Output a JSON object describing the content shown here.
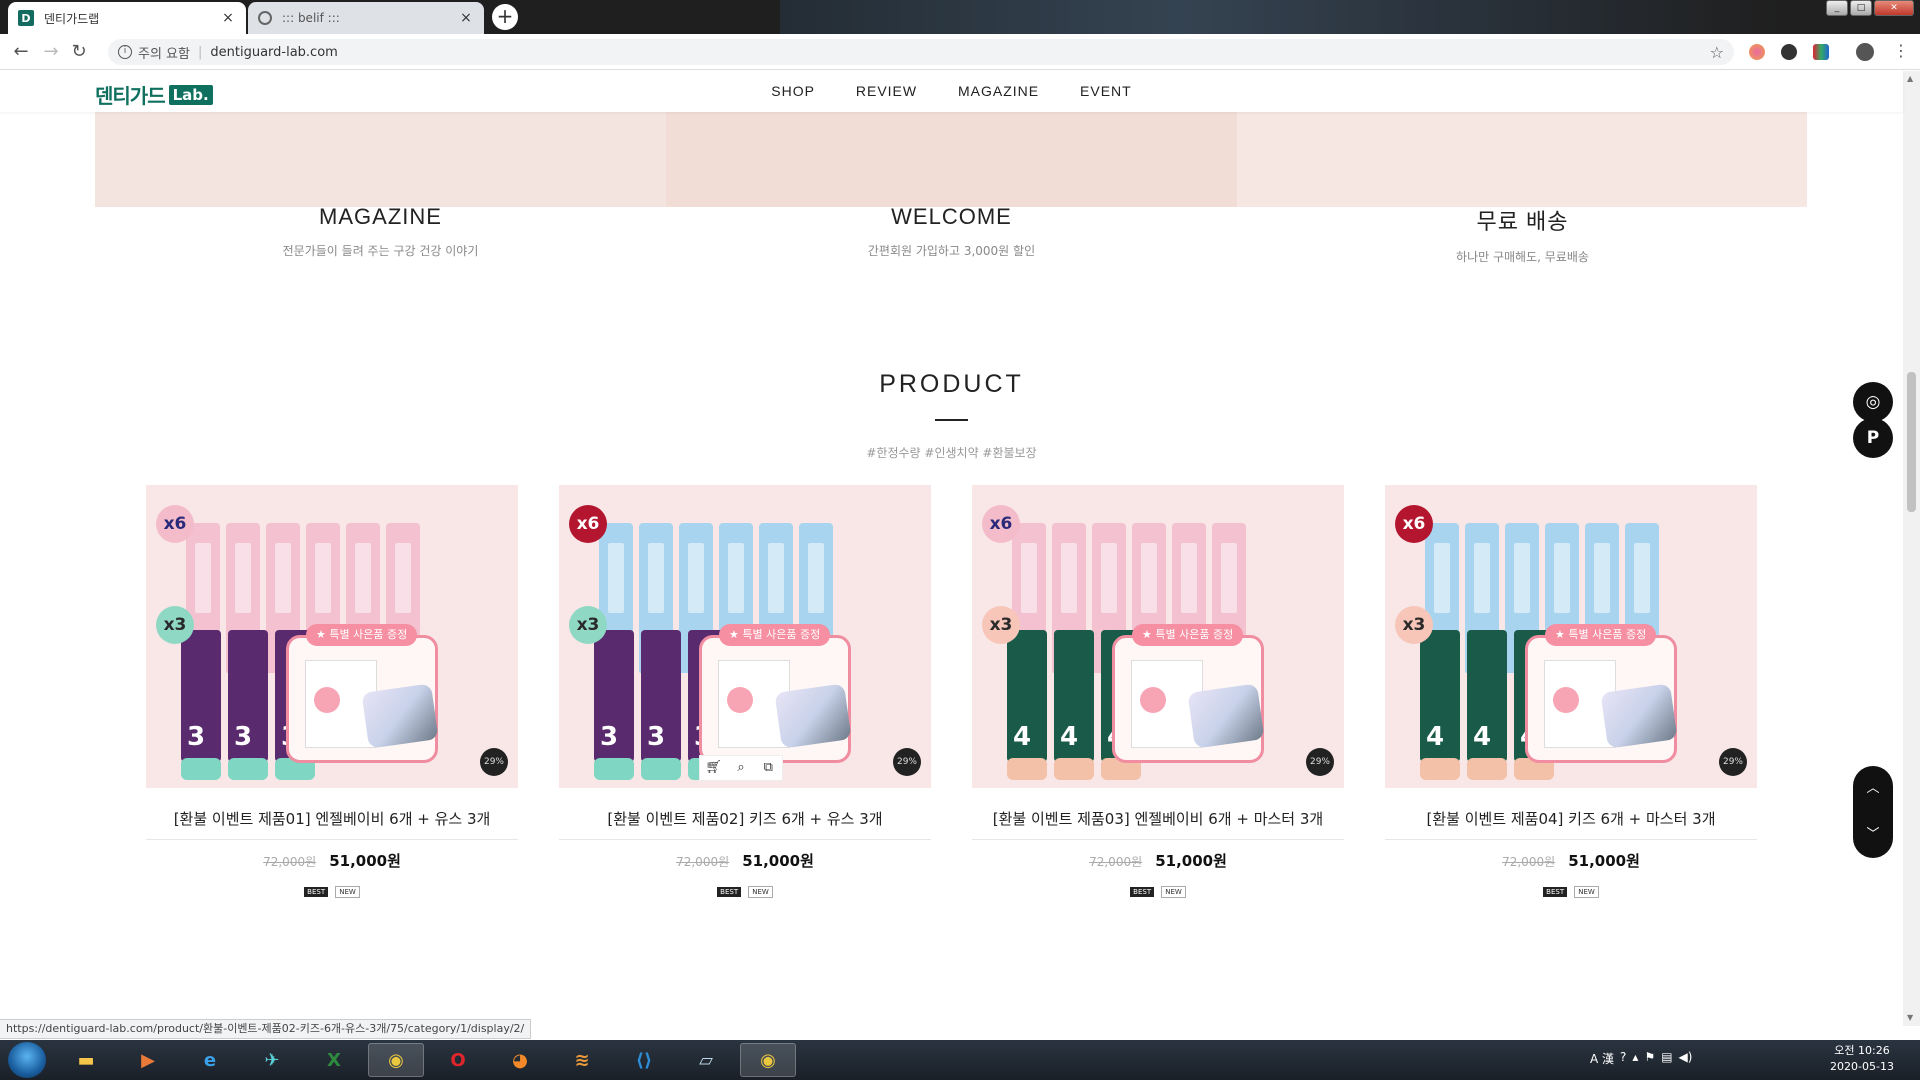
{
  "browser": {
    "tabs": [
      {
        "title": "덴티가드랩",
        "favicon": "D",
        "active": true
      },
      {
        "title": "::: belif :::",
        "active": false
      }
    ],
    "close_glyph": "×",
    "new_tab_glyph": "+",
    "address": {
      "security_label": "주의 요함",
      "url": "dentiguard-lab.com"
    },
    "status_url": "https://dentiguard-lab.com/product/환불-이벤트-제품02-키즈-6개-유스-3개/75/category/1/display/2/"
  },
  "site": {
    "logo": {
      "text": "덴티가드",
      "badge": "Lab."
    },
    "nav": [
      "SHOP",
      "REVIEW",
      "MAGAZINE",
      "EVENT"
    ],
    "promos": [
      {
        "title": "MAGAZINE",
        "subtitle": "전문가들이 들려 주는 구강 건강 이야기"
      },
      {
        "title": "WELCOME",
        "subtitle": "간편회원 가입하고 3,000원 할인"
      },
      {
        "title": "무료 배송",
        "subtitle": "하나만 구매해도, 무료배송"
      }
    ],
    "section": {
      "title": "PRODUCT",
      "tags": "#한정수량 #인생치약 #환불보장"
    },
    "products": [
      {
        "name": "[환불 이벤트 제품01] 엔젤베이비 6개 + 유스 3개",
        "old_price": "72,000원",
        "price": "51,000원",
        "badge_top": "x6",
        "badge_mid": "x3",
        "gift_label": "★ 특별 사은품 증정",
        "discount": "29%",
        "tag_best": "BEST",
        "tag_new": "NEW",
        "tube_color": "#f3c1d0",
        "tube_num": "3"
      },
      {
        "name": "[환불 이벤트 제품02] 키즈 6개 + 유스 3개",
        "old_price": "72,000원",
        "price": "51,000원",
        "badge_top": "x6",
        "badge_mid": "x3",
        "gift_label": "★ 특별 사은품 증정",
        "discount": "29%",
        "tag_best": "BEST",
        "tag_new": "NEW",
        "tube_color": "#a9d4ef",
        "tube_num": "3"
      },
      {
        "name": "[환불 이벤트 제품03] 엔젤베이비 6개 + 마스터 3개",
        "old_price": "72,000원",
        "price": "51,000원",
        "badge_top": "x6",
        "badge_mid": "x3",
        "gift_label": "★ 특별 사은품 증정",
        "discount": "29%",
        "tag_best": "BEST",
        "tag_new": "NEW",
        "tube_color": "#f3c1d0",
        "tube_num": "4"
      },
      {
        "name": "[환불 이벤트 제품04] 키즈 6개 + 마스터 3개",
        "old_price": "72,000원",
        "price": "51,000원",
        "badge_top": "x6",
        "badge_mid": "x3",
        "gift_label": "★ 특별 사은품 증정",
        "discount": "29%",
        "tag_best": "BEST",
        "tag_new": "NEW",
        "tube_color": "#a9d4ef",
        "tube_num": "4"
      }
    ]
  },
  "taskbar": {
    "clock_time": "오전 10:26",
    "clock_date": "2020-05-13",
    "tray_ime": "A 漢"
  },
  "colors": {
    "brand": "#0f7060",
    "pink_bg": "#f8e7e6",
    "gift_border": "#f08da1"
  }
}
